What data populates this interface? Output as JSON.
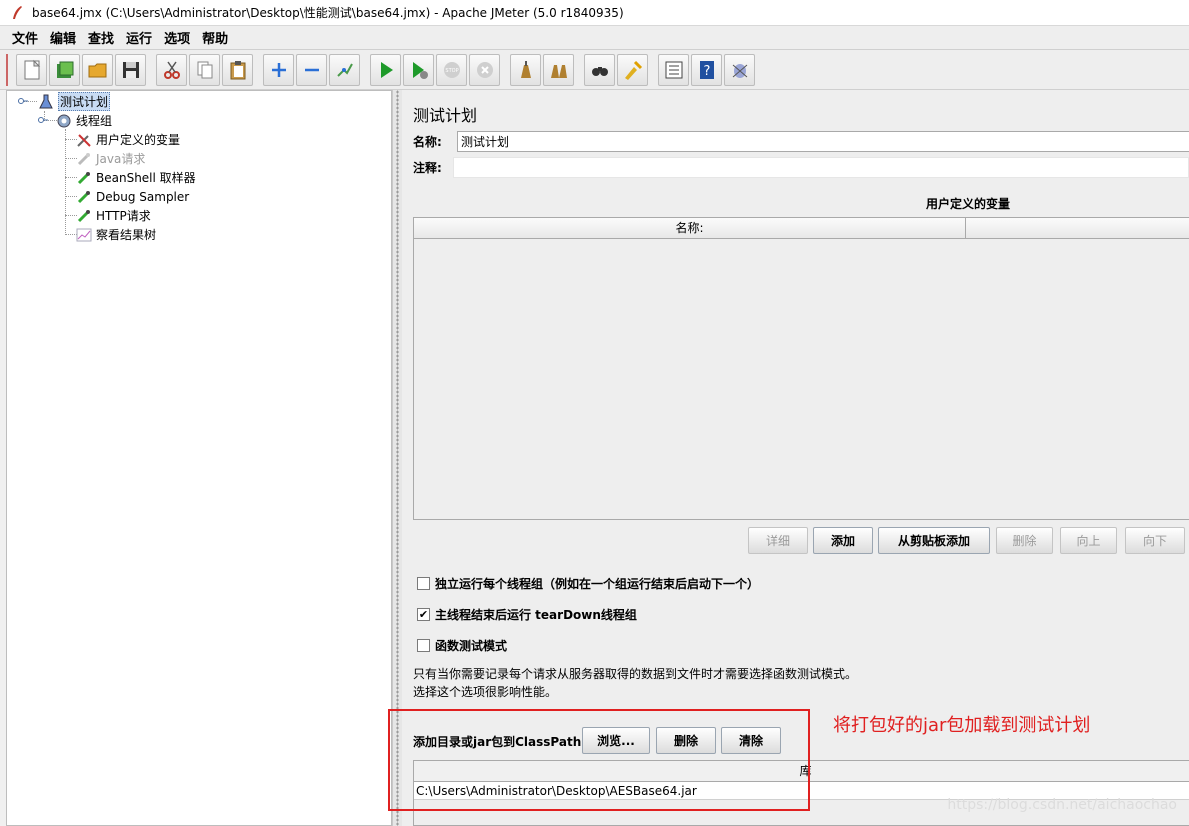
{
  "window": {
    "title": "base64.jmx (C:\\Users\\Administrator\\Desktop\\性能测试\\base64.jmx) - Apache JMeter (5.0 r1840935)"
  },
  "menu": [
    "文件",
    "编辑",
    "查找",
    "运行",
    "选项",
    "帮助"
  ],
  "toolbar": {
    "buttons": [
      "new-icon",
      "templates-icon",
      "open-icon",
      "save-icon",
      "cut-icon",
      "copy-icon",
      "paste-icon",
      "expand-icon",
      "collapse-icon",
      "toggle-icon",
      "start-icon",
      "start-no-pauses-icon",
      "stop-icon",
      "shutdown-icon",
      "clear-icon",
      "clear-all-icon",
      "search-icon",
      "reset-search-icon",
      "function-helper-icon",
      "help-icon",
      "log-icon"
    ]
  },
  "tree": {
    "test_plan": "测试计划",
    "thread_group": "线程组",
    "items": [
      {
        "label": "用户定义的变量",
        "icon": "tools-icon",
        "disabled": false
      },
      {
        "label": "Java请求",
        "icon": "pipette-icon",
        "disabled": true
      },
      {
        "label": "BeanShell 取样器",
        "icon": "pipette-icon",
        "disabled": false
      },
      {
        "label": "Debug Sampler",
        "icon": "pipette-icon",
        "disabled": false
      },
      {
        "label": "HTTP请求",
        "icon": "pipette-icon",
        "disabled": false
      },
      {
        "label": "察看结果树",
        "icon": "chart-icon",
        "disabled": false
      }
    ]
  },
  "panel": {
    "title": "测试计划",
    "name_label": "名称:",
    "name_value": "测试计划",
    "comment_label": "注释:",
    "comment_value": "",
    "vars_title": "用户定义的变量",
    "vars_col_name": "名称:",
    "vars_col_value": "",
    "buttons": {
      "detail": "详细",
      "add": "添加",
      "add_clipboard": "从剪贴板添加",
      "delete": "删除",
      "up": "向上",
      "down": "向下"
    },
    "checks": {
      "independent": {
        "label": "独立运行每个线程组（例如在一个组运行结束后启动下一个）",
        "checked": false
      },
      "teardown": {
        "label": "主线程结束后运行 tearDown线程组",
        "checked": true
      },
      "functional": {
        "label": "函数测试模式",
        "checked": false
      }
    },
    "info_line1": "只有当你需要记录每个请求从服务器取得的数据到文件时才需要选择函数测试模式。",
    "info_line2": "选择这个选项很影响性能。",
    "classpath_label": "添加目录或jar包到ClassPath",
    "browse": "浏览...",
    "remove": "删除",
    "clear": "清除",
    "lib_header": "库",
    "lib_rows": [
      "C:\\Users\\Administrator\\Desktop\\AESBase64.jar"
    ]
  },
  "annotation": "将打包好的jar包加载到测试计划",
  "watermark": "https://blog.csdn.net/aichaochao",
  "colors": {
    "annotation_red": "#e02020",
    "selection": "#c9dcf4"
  }
}
